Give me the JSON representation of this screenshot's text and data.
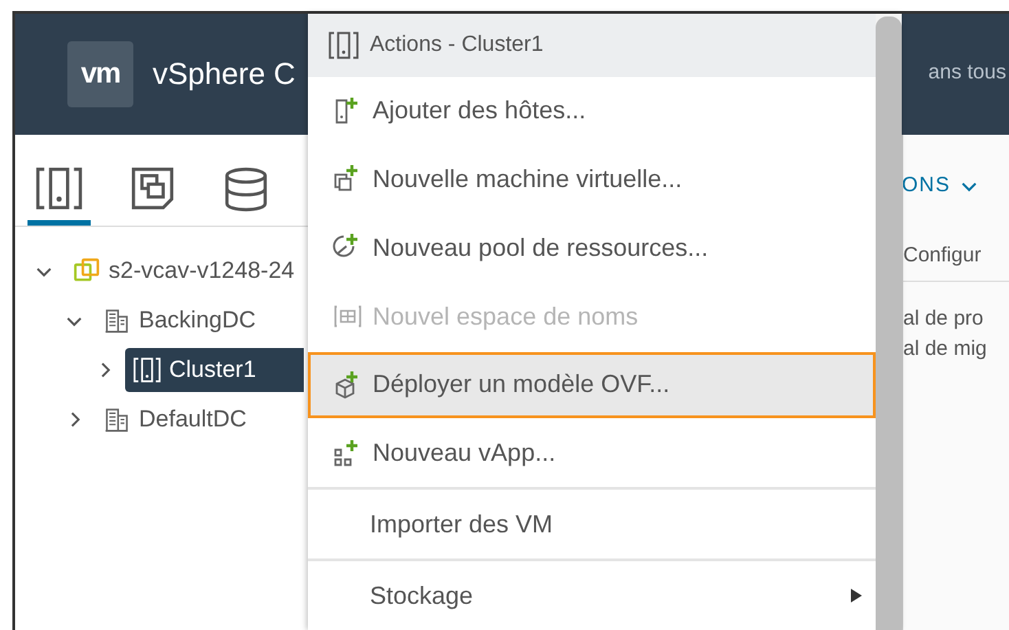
{
  "header": {
    "logo": "vm",
    "title": "vSphere C",
    "search_text": "ans tous"
  },
  "nav_tabs": [
    {
      "kind": "hosts",
      "selected": true
    },
    {
      "kind": "vms",
      "selected": false
    },
    {
      "kind": "storage",
      "selected": false
    }
  ],
  "tree": [
    {
      "label": "s2-vcav-v1248-24",
      "kind": "vcenter",
      "expanded": true,
      "selected": false,
      "children": [
        {
          "label": "BackingDC",
          "kind": "datacenter",
          "expanded": true,
          "selected": false,
          "children": [
            {
              "label": "Cluster1",
              "kind": "cluster",
              "expanded": false,
              "selected": true
            }
          ]
        },
        {
          "label": "DefaultDC",
          "kind": "datacenter",
          "expanded": false,
          "selected": false
        }
      ]
    }
  ],
  "context_menu": {
    "title": "Actions - Cluster1",
    "items": [
      {
        "label": "Ajouter des hôtes...",
        "kind": "add-host",
        "disabled": false,
        "selected": false,
        "separator_before": false,
        "submenu": false
      },
      {
        "label": "Nouvelle machine virtuelle...",
        "kind": "new-vm",
        "disabled": false,
        "selected": false,
        "separator_before": false,
        "submenu": false
      },
      {
        "label": "Nouveau pool de ressources...",
        "kind": "new-pool",
        "disabled": false,
        "selected": false,
        "separator_before": false,
        "submenu": false
      },
      {
        "label": "Nouvel espace de noms",
        "kind": "namespace",
        "disabled": true,
        "selected": false,
        "separator_before": false,
        "submenu": false
      },
      {
        "label": "Déployer un modèle OVF...",
        "kind": "deploy-ovf",
        "disabled": false,
        "selected": true,
        "separator_before": false,
        "submenu": false
      },
      {
        "label": "Nouveau vApp...",
        "kind": "new-vapp",
        "disabled": false,
        "selected": false,
        "separator_before": false,
        "submenu": false
      },
      {
        "label": "Importer des VM",
        "kind": "plain",
        "disabled": false,
        "selected": false,
        "separator_before": true,
        "submenu": false
      },
      {
        "label": "Stockage",
        "kind": "plain",
        "disabled": false,
        "selected": false,
        "separator_before": true,
        "submenu": true
      }
    ]
  },
  "right_panel": {
    "actions_label": "ONS",
    "tab_label": "Configur",
    "lines": [
      "al de pro",
      "al de mig"
    ]
  }
}
